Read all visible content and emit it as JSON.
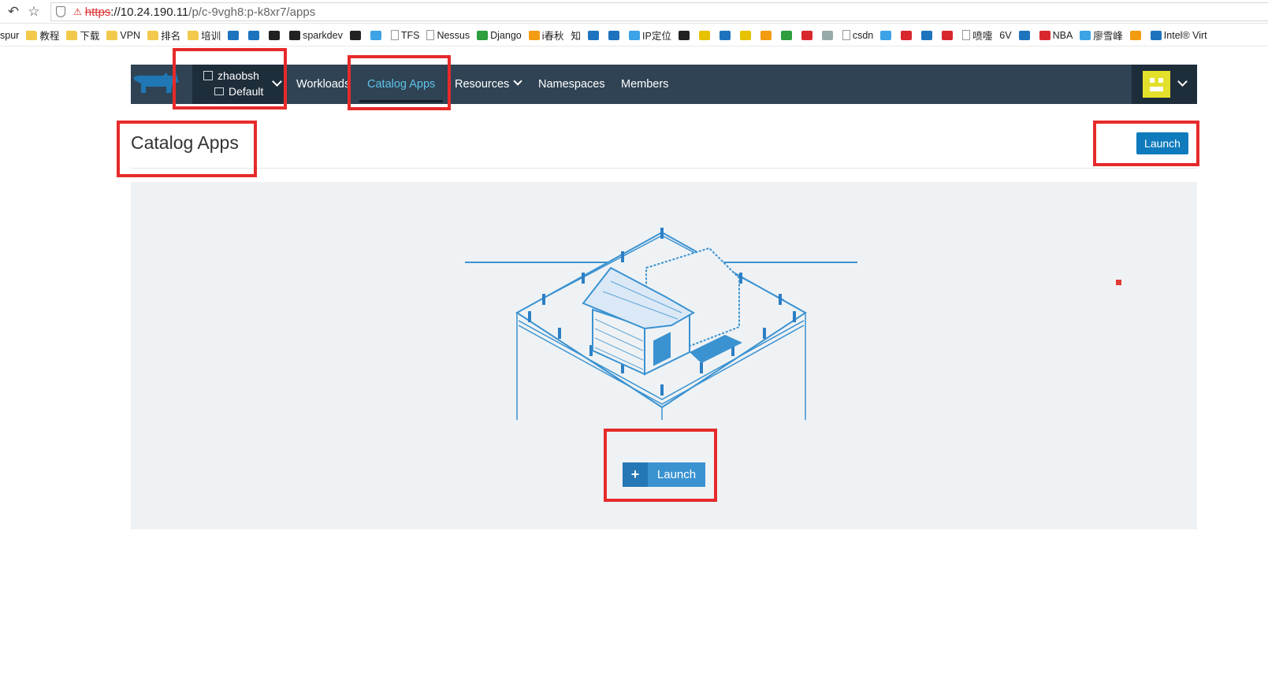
{
  "browser": {
    "url_protocol": "https",
    "url_host": "://10.24.190.11",
    "url_path": "/p/c-9vgh8:p-k8xr7/apps"
  },
  "bookmarks": [
    {
      "label": "spur",
      "icon": "none"
    },
    {
      "label": "教程",
      "icon": "folder"
    },
    {
      "label": "下载",
      "icon": "folder"
    },
    {
      "label": "VPN",
      "icon": "folder"
    },
    {
      "label": "排名",
      "icon": "folder"
    },
    {
      "label": "培训",
      "icon": "folder"
    },
    {
      "label": "",
      "icon": "c-blue"
    },
    {
      "label": "",
      "icon": "c-blue"
    },
    {
      "label": "",
      "icon": "c-dark"
    },
    {
      "label": "sparkdev",
      "icon": "c-dark"
    },
    {
      "label": "",
      "icon": "c-dark"
    },
    {
      "label": "",
      "icon": "c-sky"
    },
    {
      "label": "TFS",
      "icon": "page"
    },
    {
      "label": "Nessus",
      "icon": "page"
    },
    {
      "label": "Django",
      "icon": "c-green"
    },
    {
      "label": "i春秋",
      "icon": "c-orange"
    },
    {
      "label": "知",
      "icon": "none"
    },
    {
      "label": "",
      "icon": "c-blue"
    },
    {
      "label": "",
      "icon": "c-blue"
    },
    {
      "label": "IP定位",
      "icon": "c-sky"
    },
    {
      "label": "",
      "icon": "c-dark"
    },
    {
      "label": "",
      "icon": "c-yellow"
    },
    {
      "label": "",
      "icon": "c-blue"
    },
    {
      "label": "",
      "icon": "c-yellow"
    },
    {
      "label": "",
      "icon": "c-orange"
    },
    {
      "label": "",
      "icon": "c-green"
    },
    {
      "label": "",
      "icon": "c-red"
    },
    {
      "label": "",
      "icon": "c-grey"
    },
    {
      "label": "csdn",
      "icon": "page"
    },
    {
      "label": "",
      "icon": "c-sky"
    },
    {
      "label": "",
      "icon": "c-red"
    },
    {
      "label": "",
      "icon": "c-blue"
    },
    {
      "label": "",
      "icon": "c-red"
    },
    {
      "label": "喷嚏",
      "icon": "page"
    },
    {
      "label": "6V",
      "icon": "none"
    },
    {
      "label": "",
      "icon": "c-blue"
    },
    {
      "label": "NBA",
      "icon": "c-red"
    },
    {
      "label": "廖雪峰",
      "icon": "c-sky"
    },
    {
      "label": "",
      "icon": "c-orange"
    },
    {
      "label": "Intel® Virt",
      "icon": "c-blue"
    }
  ],
  "header": {
    "cluster_name": "zhaobsh",
    "project_name": "Default",
    "nav": {
      "workloads": "Workloads",
      "catalog_apps": "Catalog Apps",
      "resources": "Resources",
      "namespaces": "Namespaces",
      "members": "Members"
    }
  },
  "page": {
    "title": "Catalog Apps",
    "launch_top": "Launch",
    "launch_main": "Launch",
    "launch_plus": "+"
  },
  "colors": {
    "header_bg": "#2f4354",
    "header_dark": "#1e2d3a",
    "active_nav": "#5ec3e8",
    "primary": "#0f7bbd",
    "highlight": "#e62a2a"
  }
}
